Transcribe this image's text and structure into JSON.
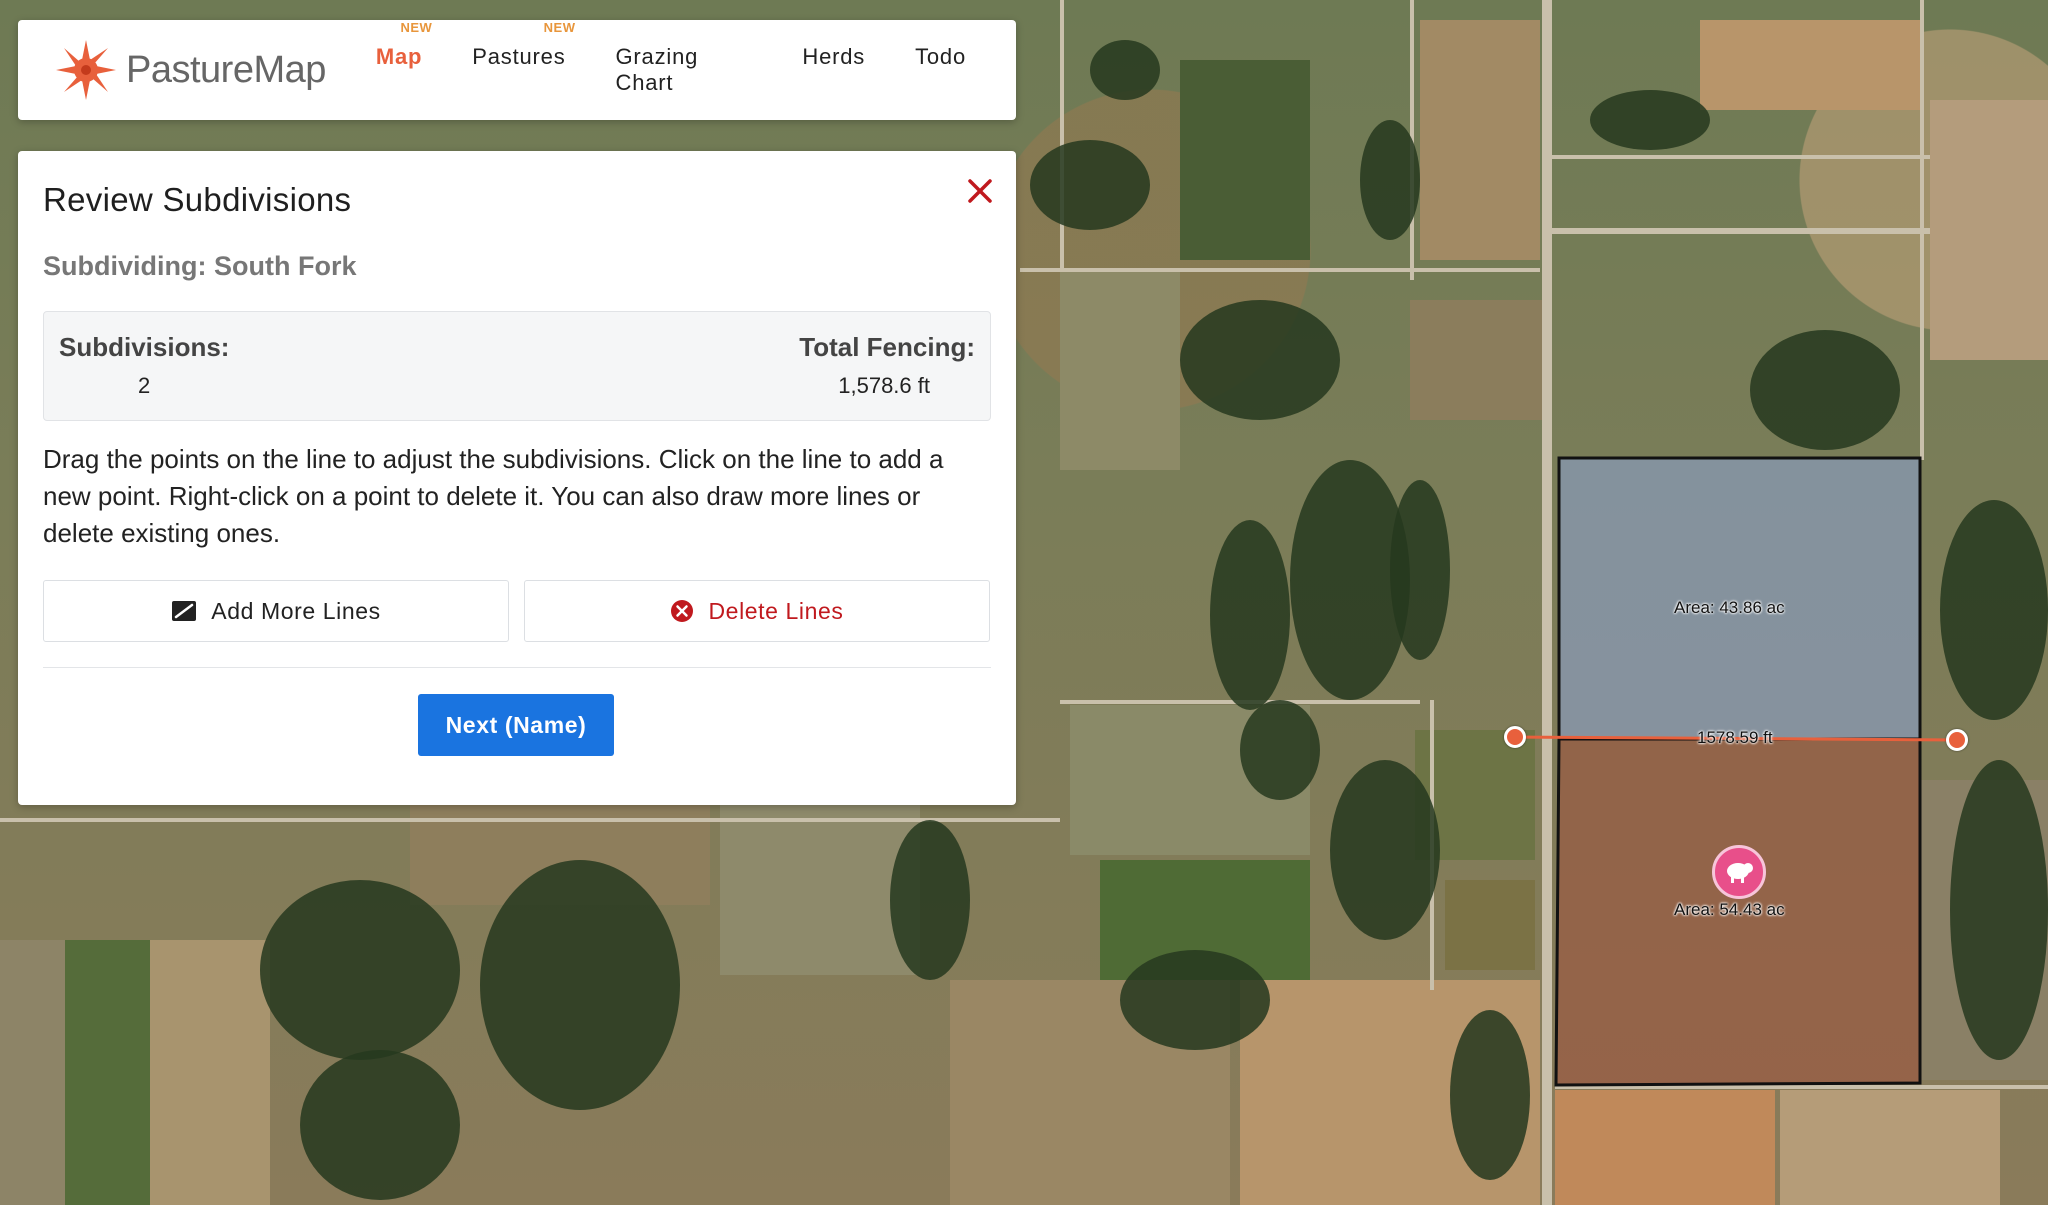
{
  "app": {
    "logo_text": "PastureMap",
    "brand_color": "#e8603c"
  },
  "nav": {
    "items": [
      {
        "label": "Map",
        "badge": "NEW",
        "active": true
      },
      {
        "label": "Pastures",
        "badge": "NEW",
        "active": false
      },
      {
        "label": "Grazing Chart",
        "badge": "",
        "active": false
      },
      {
        "label": "Herds",
        "badge": "",
        "active": false
      },
      {
        "label": "Todo",
        "badge": "",
        "active": false
      }
    ]
  },
  "panel": {
    "title": "Review Subdivisions",
    "subtitle": "Subdividing: South Fork",
    "stats": {
      "subdivisions_label": "Subdivisions:",
      "subdivisions_value": "2",
      "fencing_label": "Total Fencing:",
      "fencing_value": "1,578.6 ft"
    },
    "instructions": "Drag the points on the line to adjust the subdivisions. Click on the line to add a new point. Right-click on a point to delete it. You can also draw more lines or delete existing ones.",
    "add_lines_label": "Add More Lines",
    "delete_lines_label": "Delete Lines",
    "next_label": "Next (Name)",
    "accent_color": "#1a74e0",
    "danger_color": "#c0191e"
  },
  "map": {
    "upper_area_label": "Area: 43.86 ac",
    "lower_area_label": "Area: 54.43 ac",
    "line_length_label": "1578.59 ft",
    "upper_fill_color": "#8aa0c8",
    "lower_fill_color": "#a0503c",
    "herd_icon": "sheep-icon"
  }
}
